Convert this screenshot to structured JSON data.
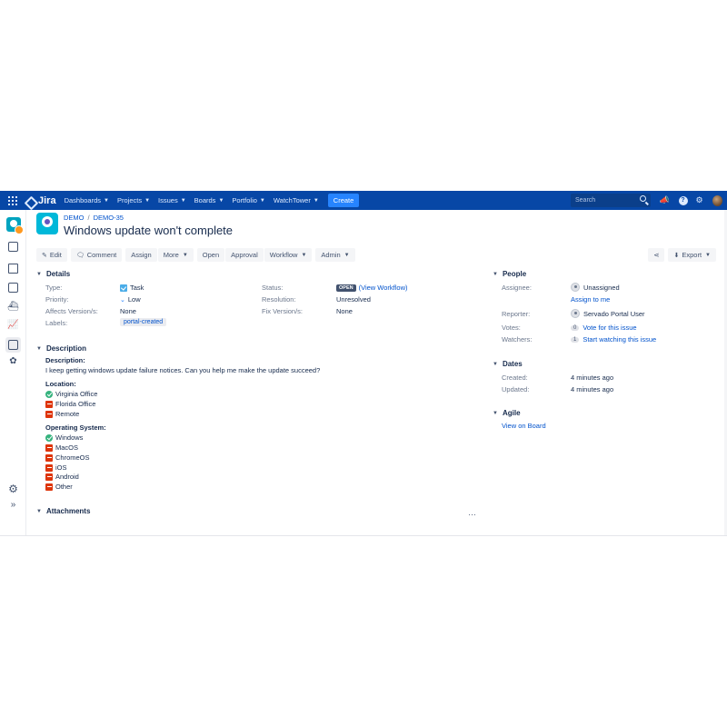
{
  "nav": {
    "logo": "Jira",
    "items": [
      {
        "label": "Dashboards"
      },
      {
        "label": "Projects"
      },
      {
        "label": "Issues"
      },
      {
        "label": "Boards"
      },
      {
        "label": "Portfolio"
      },
      {
        "label": "WatchTower"
      }
    ],
    "create_label": "Create",
    "search_placeholder": "Search",
    "help_label": "?"
  },
  "breadcrumb": {
    "project": "DEMO",
    "separator": "/",
    "issue_key": "DEMO-35"
  },
  "issue": {
    "title": "Windows update won't complete"
  },
  "toolbar": {
    "edit": "Edit",
    "comment": "Comment",
    "assign": "Assign",
    "more": "More",
    "open": "Open",
    "approval": "Approval",
    "workflow": "Workflow",
    "admin": "Admin",
    "export": "Export"
  },
  "details": {
    "heading": "Details",
    "type_label": "Type:",
    "type_value": "Task",
    "priority_label": "Priority:",
    "priority_value": "Low",
    "affects_label": "Affects Version/s:",
    "affects_value": "None",
    "labels_label": "Labels:",
    "labels_value": "portal-created",
    "status_label": "Status:",
    "status_value": "OPEN",
    "status_link": "(View Workflow)",
    "resolution_label": "Resolution:",
    "resolution_value": "Unresolved",
    "fix_label": "Fix Version/s:",
    "fix_value": "None"
  },
  "description": {
    "heading": "Description",
    "desc_title": "Description:",
    "desc_text": "I keep getting windows update failure notices. Can you help me make the update succeed?",
    "location_title": "Location:",
    "locations": [
      {
        "label": "Virginia Office",
        "checked": true
      },
      {
        "label": "Florida Office",
        "checked": false
      },
      {
        "label": "Remote",
        "checked": false
      }
    ],
    "os_title": "Operating System:",
    "os": [
      {
        "label": "Windows",
        "checked": true
      },
      {
        "label": "MacOS",
        "checked": false
      },
      {
        "label": "ChromeOS",
        "checked": false
      },
      {
        "label": "iOS",
        "checked": false
      },
      {
        "label": "Android",
        "checked": false
      },
      {
        "label": "Other",
        "checked": false
      }
    ]
  },
  "attachments": {
    "heading": "Attachments",
    "more": "…"
  },
  "people": {
    "heading": "People",
    "assignee_label": "Assignee:",
    "assignee_value": "Unassigned",
    "assign_to_me": "Assign to me",
    "reporter_label": "Reporter:",
    "reporter_value": "Servado Portal User",
    "votes_label": "Votes:",
    "votes_count": "0",
    "votes_link": "Vote for this issue",
    "watchers_label": "Watchers:",
    "watchers_count": "1",
    "watchers_link": "Start watching this issue"
  },
  "dates": {
    "heading": "Dates",
    "created_label": "Created:",
    "created_value": "4 minutes ago",
    "updated_label": "Updated:",
    "updated_value": "4 minutes ago"
  },
  "agile": {
    "heading": "Agile",
    "link": "View on Board"
  },
  "colors": {
    "nav_bg": "#0747a6",
    "create_btn": "#2684ff",
    "link": "#0052cc",
    "ok": "#36b37e",
    "no": "#de350b"
  }
}
